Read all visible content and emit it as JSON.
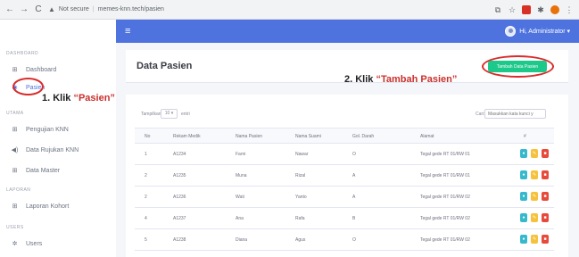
{
  "browser": {
    "back": "←",
    "forward": "→",
    "reload": "C",
    "security_icon": "warning-icon",
    "security_label": "Not secure",
    "url": "memes-knn.tech/pasien"
  },
  "topbar": {
    "user_name": "Hi, Administrator ▾"
  },
  "sidebar": {
    "sections": {
      "dashboard": "DASHBOARD",
      "utama": "UTAMA",
      "laporan": "LAPORAN",
      "users": "USERS"
    },
    "items": [
      {
        "label": "Dashboard",
        "icon": "⊞"
      },
      {
        "label": "Pasien",
        "icon": "◉"
      },
      {
        "label": "Pengujian KNN",
        "icon": "⊞"
      },
      {
        "label": "Data Rujukan KNN",
        "icon": "◀)"
      },
      {
        "label": "Data Master",
        "icon": "⊞"
      },
      {
        "label": "Laporan Kohort",
        "icon": "⊞"
      },
      {
        "label": "Users",
        "icon": "✲"
      }
    ]
  },
  "page": {
    "title": "Data Pasien",
    "add_button": "Tambah Data Pasien",
    "show_label": "Tampilkan",
    "entries_value": "10 ▾",
    "entries_label": "entri",
    "search_label": "Cari:",
    "search_placeholder": "Masukkan kata kunci y"
  },
  "annotations": {
    "step1_prefix": "1. Klik ",
    "step1_target": "“Pasien”",
    "step2_prefix": "2. Klik ",
    "step2_target": "“Tambah Pasien”"
  },
  "table": {
    "headers": [
      "No",
      "Rekam Medik",
      "Nama Pasien",
      "Nama Suami",
      "Gol. Darah",
      "Alamat",
      "#"
    ],
    "rows": [
      [
        "1",
        "A1234",
        "Farni",
        "Nawar",
        "O",
        "Tegal gede RT 01/RW 01"
      ],
      [
        "2",
        "A1235",
        "Muna",
        "Rizal",
        "A",
        "Tegal gede RT 01/RW 01"
      ],
      [
        "2",
        "A1236",
        "Wati",
        "Yanto",
        "A",
        "Tegal gede RT 01/RW 02"
      ],
      [
        "4",
        "A1237",
        "Ana",
        "Rafa",
        "B",
        "Tegal gede RT 01/RW 02"
      ],
      [
        "5",
        "A1238",
        "Diana",
        "Agus",
        "O",
        "Tegal gede RT 01/RW 02"
      ]
    ],
    "action_icons": {
      "view": "eye-icon",
      "edit": "edit-icon",
      "delete": "trash-icon"
    }
  },
  "colors": {
    "primary": "#4e73df",
    "success": "#1cc88a",
    "info": "#36b9cc",
    "warning": "#f6c23e",
    "danger": "#e74a3b",
    "annotation": "#d92b2b"
  }
}
